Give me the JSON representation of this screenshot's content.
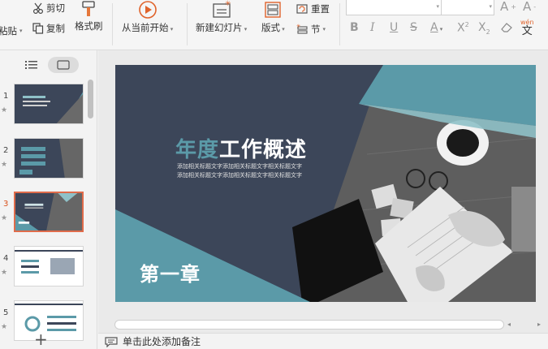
{
  "ribbon": {
    "paste_label": "粘贴",
    "cut_label": "剪切",
    "copy_label": "复制",
    "format_painter_label": "格式刷",
    "from_current_label": "从当前开始",
    "new_slide_label": "新建幻灯片",
    "layout_label": "版式",
    "reset_label": "重置",
    "section_label": "节",
    "phonetic_label": "wén",
    "phonetic_char": "文"
  },
  "left_panel": {
    "thumbnails": [
      {
        "number": "1",
        "active": false
      },
      {
        "number": "2",
        "active": false
      },
      {
        "number": "3",
        "active": true
      },
      {
        "number": "4",
        "active": false
      },
      {
        "number": "5",
        "active": false
      }
    ],
    "add_symbol": "+"
  },
  "slide": {
    "title_accent": "年度",
    "title_rest": "工作概述",
    "subtitle_line1": "添加相关标题文字添加相关标题文字相关标题文字",
    "subtitle_line2": "添加相关标题文字添加相关标题文字相关标题文字",
    "chapter": "第一章",
    "colors": {
      "dark": "#3c4659",
      "teal": "#5b9aa8",
      "light_teal": "#8fc1c8",
      "white": "#ffffff"
    }
  },
  "notes": {
    "placeholder": "单击此处添加备注"
  }
}
